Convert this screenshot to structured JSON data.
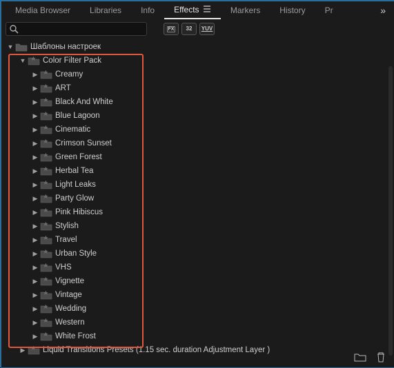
{
  "tabs": {
    "t0": "Media Browser",
    "t1": "Libraries",
    "t2": "Info",
    "t3": "Effects",
    "t4": "Markers",
    "t5": "History",
    "t6": "Pr"
  },
  "overflow": "»",
  "search": {
    "placeholder": ""
  },
  "badges": {
    "b0": "FX",
    "b1": "32",
    "b2": "YUV"
  },
  "tree": {
    "root": "Шаблоны настроек",
    "pack": "Color Filter Pack",
    "items": {
      "i0": "Creamy",
      "i1": "ART",
      "i2": "Black And White",
      "i3": "Blue Lagoon",
      "i4": "Cinematic",
      "i5": "Crimson Sunset",
      "i6": "Green Forest",
      "i7": "Herbal Tea",
      "i8": "Light Leaks",
      "i9": "Party Glow",
      "i10": "Pink Hibiscus",
      "i11": "Stylish",
      "i12": "Travel",
      "i13": "Urban Style",
      "i14": "VHS",
      "i15": "Vignette",
      "i16": "Vintage",
      "i17": "Wedding",
      "i18": "Western",
      "i19": "White Frost"
    },
    "after": "Liquid Transitions Presets (1.15 sec. duration Adjustment Layer )"
  }
}
